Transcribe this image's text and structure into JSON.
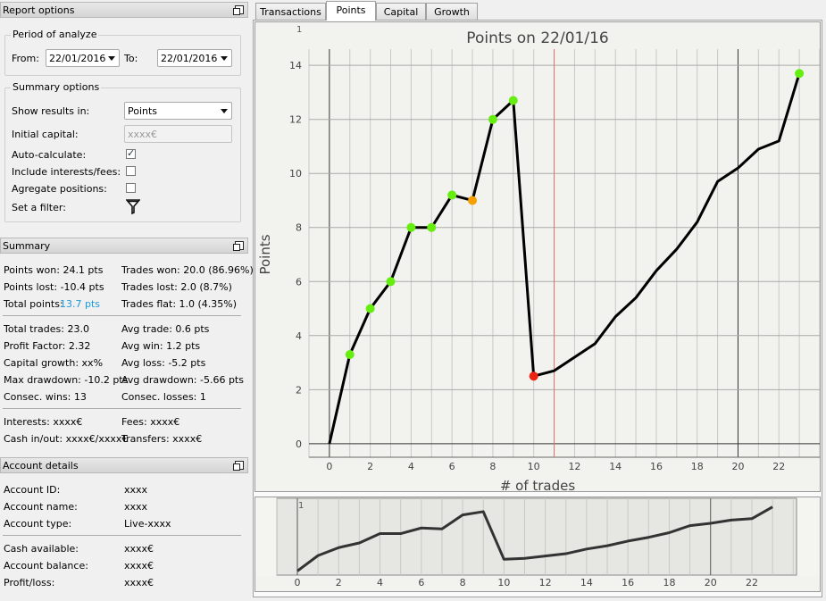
{
  "report_options": {
    "title": "Report options",
    "period_title": "Period of analyze",
    "from_label": "From:",
    "from_value": "22/01/2016",
    "to_label": "To:",
    "to_value": "22/01/2016",
    "summary_title": "Summary options",
    "show_results_label": "Show results in:",
    "show_results_value": "Points",
    "initial_capital_label": "Initial capital:",
    "initial_capital_placeholder": "xxxx€",
    "auto_calc_label": "Auto-calculate:",
    "auto_calc_checked": true,
    "include_fees_label": "Include interests/fees:",
    "include_fees_checked": false,
    "aggregate_label": "Agregate positions:",
    "aggregate_checked": false,
    "filter_label": "Set a filter:",
    "filter_icon": "filter-funnel-icon"
  },
  "summary": {
    "title": "Summary",
    "points_won": "Points won: 24.1 pts",
    "trades_won": "Trades won: 20.0 (86.96%)",
    "points_lost": "Points lost: -10.4 pts",
    "trades_lost": "Trades lost: 2.0 (8.7%)",
    "total_points_label": "Total points:",
    "total_points_value": "13.7 pts",
    "total_points_color": "#1e9bd7",
    "trades_flat": "Trades flat: 1.0 (4.35%)",
    "total_trades": "Total trades: 23.0",
    "avg_trade": "Avg trade: 0.6 pts",
    "profit_factor": "Profit Factor: 2.32",
    "avg_win": "Avg win: 1.2 pts",
    "capital_growth": "Capital growth: xx%",
    "avg_loss": "Avg loss: -5.2 pts",
    "max_drawdown": "Max drawdown: -10.2 pts",
    "avg_drawdown": "Avg drawdown: -5.66 pts",
    "consec_wins": "Consec. wins: 13",
    "consec_losses": "Consec. losses: 1",
    "interests": "Interests: xxxx€",
    "fees": "Fees: xxxx€",
    "cash_in_out": "Cash in/out: xxxx€/xxxx€",
    "transfers": "Transfers: xxxx€"
  },
  "account": {
    "title": "Account details",
    "rows": [
      {
        "label": "Account ID:",
        "value": "xxxx"
      },
      {
        "label": "Account name:",
        "value": "xxxx"
      },
      {
        "label": "Account type:",
        "value": "Live-xxxx"
      },
      {
        "label": "Cash available:",
        "value": "xxxx€"
      },
      {
        "label": "Account balance:",
        "value": "xxxx€"
      },
      {
        "label": "Profit/loss:",
        "value": "xxxx€"
      }
    ]
  },
  "tabs": [
    "Transactions",
    "Points",
    "Capital",
    "Growth"
  ],
  "active_tab": "Points",
  "colors": {
    "win": "#66ee11",
    "loss": "#ee2211",
    "flat": "#f5a000",
    "line": "#000000",
    "marker_line": "#e07070"
  },
  "chart_data": [
    {
      "type": "line",
      "title": "Points on 22/01/16",
      "xlabel": "# of trades",
      "ylabel": "Points",
      "corner_labels": [
        "1"
      ],
      "xlim": [
        -1,
        24
      ],
      "ylim": [
        -0.5,
        14.6
      ],
      "xticks": [
        0,
        2,
        4,
        6,
        8,
        10,
        12,
        14,
        16,
        18,
        20,
        22
      ],
      "yticks": [
        0,
        2,
        4,
        6,
        8,
        10,
        12,
        14
      ],
      "vertical_marker_x": 11,
      "grid": true,
      "x": [
        0,
        1,
        2,
        3,
        4,
        5,
        6,
        7,
        8,
        9,
        10,
        11,
        12,
        13,
        14,
        15,
        16,
        17,
        18,
        19,
        20,
        21,
        22,
        23
      ],
      "y": [
        0,
        3.3,
        5.0,
        6.0,
        8.0,
        8.0,
        9.2,
        9.0,
        12.0,
        12.7,
        2.5,
        2.7,
        3.2,
        3.7,
        4.7,
        5.4,
        6.4,
        7.2,
        8.2,
        9.7,
        10.2,
        10.9,
        11.2,
        13.7
      ],
      "points": [
        {
          "x": 1,
          "y": 3.3,
          "kind": "win"
        },
        {
          "x": 2,
          "y": 5.0,
          "kind": "win"
        },
        {
          "x": 3,
          "y": 6.0,
          "kind": "win"
        },
        {
          "x": 4,
          "y": 8.0,
          "kind": "win"
        },
        {
          "x": 5,
          "y": 8.0,
          "kind": "win"
        },
        {
          "x": 6,
          "y": 9.2,
          "kind": "win"
        },
        {
          "x": 7,
          "y": 9.0,
          "kind": "flat"
        },
        {
          "x": 8,
          "y": 12.0,
          "kind": "win"
        },
        {
          "x": 9,
          "y": 12.7,
          "kind": "win"
        },
        {
          "x": 10,
          "y": 2.5,
          "kind": "loss"
        },
        {
          "x": 23,
          "y": 13.7,
          "kind": "win"
        }
      ]
    },
    {
      "type": "area",
      "title": "",
      "corner_labels": [
        "1"
      ],
      "xlim": [
        -1,
        24
      ],
      "xticks": [
        0,
        2,
        4,
        6,
        8,
        10,
        12,
        14,
        16,
        18,
        20,
        22
      ],
      "x": [
        0,
        1,
        2,
        3,
        4,
        5,
        6,
        7,
        8,
        9,
        10,
        11,
        12,
        13,
        14,
        15,
        16,
        17,
        18,
        19,
        20,
        21,
        22,
        23
      ],
      "y": [
        0,
        3.3,
        5.0,
        6.0,
        8.0,
        8.0,
        9.2,
        9.0,
        12.0,
        12.7,
        2.5,
        2.7,
        3.2,
        3.7,
        4.7,
        5.4,
        6.4,
        7.2,
        8.2,
        9.7,
        10.2,
        10.9,
        11.2,
        13.7
      ]
    }
  ]
}
